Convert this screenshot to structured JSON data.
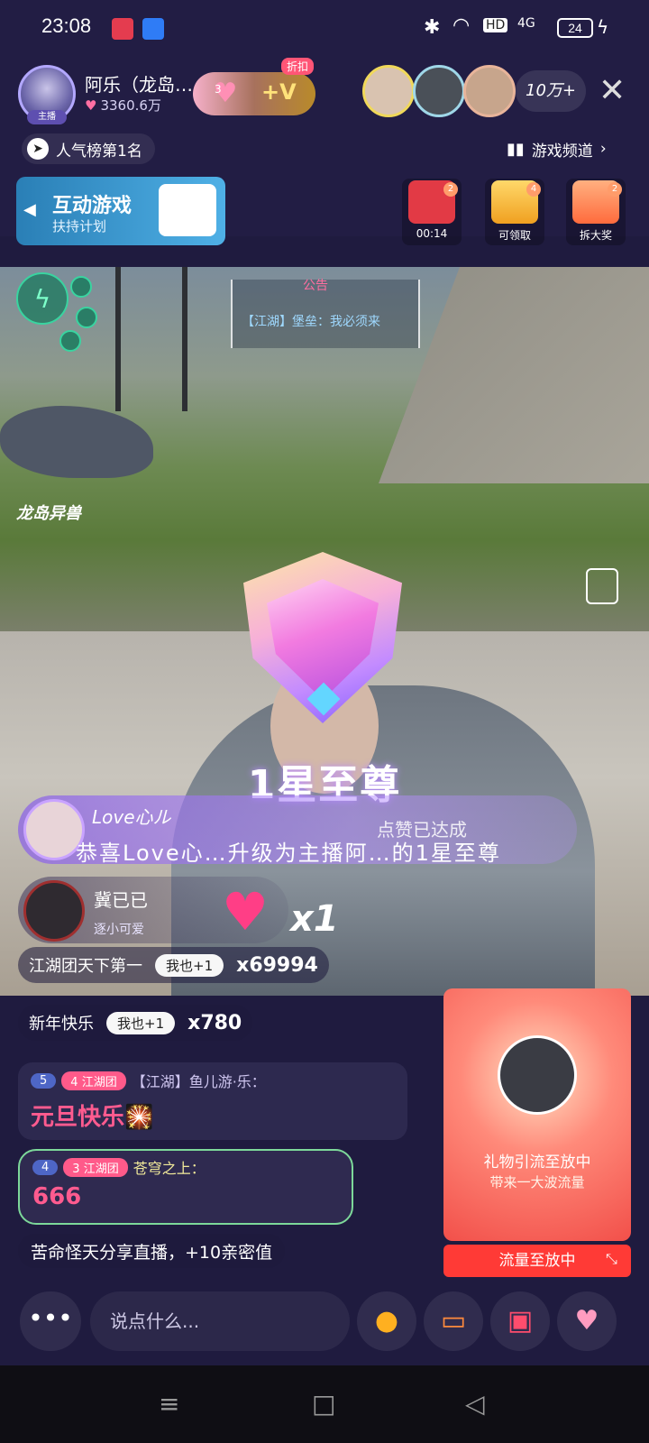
{
  "status": {
    "time": "23:08",
    "hd": "HD",
    "net": "4G",
    "battery": "24"
  },
  "anchor": {
    "name": "阿乐（龙岛…",
    "likes": "3360.6万",
    "badge": "主播"
  },
  "gift_pill": {
    "heart_num": "3",
    "v_label": "+V",
    "discount": "折扣"
  },
  "viewers": {
    "count": "10万+"
  },
  "rank": {
    "label": "人气榜第1名"
  },
  "channel": {
    "label": "游戏频道"
  },
  "game_card": {
    "title": "互动游戏",
    "subtitle": "扶持计划"
  },
  "activities": [
    {
      "label": "00:14",
      "dot": "2"
    },
    {
      "label": "可领取",
      "dot": "4"
    },
    {
      "label": "拆大奖",
      "dot": "2"
    }
  ],
  "game_view": {
    "logo": "龙岛异兽",
    "notice_title": "公告",
    "notice_text": "【江湖】堡垒：我必须来"
  },
  "badge": {
    "title": "1星至尊"
  },
  "upgrade": {
    "user": "Love心ル",
    "like_done": "点赞已达成",
    "text": "恭喜Love心…升级为主播阿…的1星至尊"
  },
  "like": {
    "name": "冀已已",
    "sub": "逐小可爱",
    "count": "x1"
  },
  "commands": [
    {
      "text": "江湖团天下第一",
      "me_too": "我也+1",
      "count": "x69994"
    },
    {
      "text": "新年快乐",
      "me_too": "我也+1",
      "count": "x780"
    }
  ],
  "messages": [
    {
      "lvl1": "5",
      "lvl2": "4",
      "tag": "江湖团",
      "user": "【江湖】鱼儿游·乐：",
      "content": "元旦快乐🎇"
    },
    {
      "lvl1": "4",
      "lvl2": "3",
      "tag": "江湖团",
      "user": "苍穹之上：",
      "content": "666"
    }
  ],
  "system_msg": "苦命怪天分享直播，+10亲密值",
  "promo": {
    "line1": "礼物引流至放中",
    "line2": "带来一大波流量",
    "button": "流量至放中"
  },
  "bottom": {
    "more": "•••",
    "placeholder": "说点什么..."
  },
  "colors": {
    "background": "#1f1b3f",
    "accent_pink": "#ff5a8a",
    "promo_red": "#f2504a"
  }
}
